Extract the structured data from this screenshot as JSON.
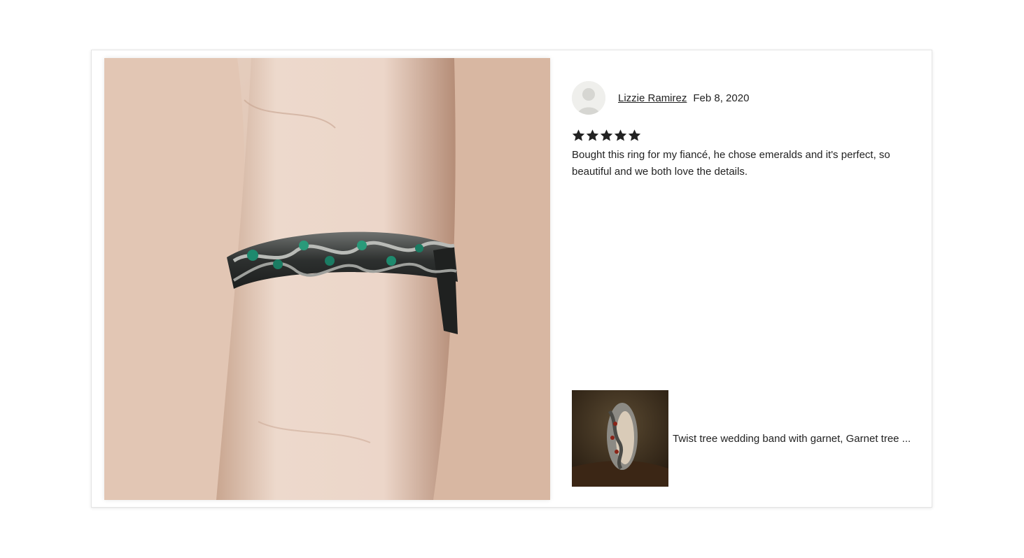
{
  "review": {
    "reviewer_name": "Lizzie Ramirez",
    "date": "Feb 8, 2020",
    "rating": 5,
    "rating_max": 5,
    "star_glyph": "★",
    "text": "Bought this ring for my fiancé, he chose emeralds and it's perfect, so beautiful and we both love the details."
  },
  "photo": {
    "subject": "braided tree ring with emeralds on finger",
    "icon": "review-photo"
  },
  "item": {
    "title": "Twist tree wedding band with garnet, Garnet tree ...",
    "icon": "item-thumbnail"
  },
  "colors": {
    "text": "#222222",
    "border": "#e4e4e4",
    "avatar_bg": "#efefec"
  }
}
